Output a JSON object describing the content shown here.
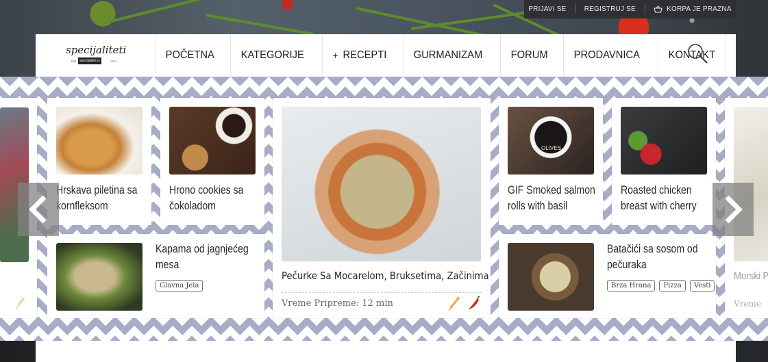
{
  "topbar": {
    "login": "PRIJAVI SE",
    "register": "REGISTRUJ SE",
    "cart": "KORPA JE PRAZNA"
  },
  "logo": {
    "text": "specijaliteti",
    "badge": "specijaliteti.rs",
    "year_left": "EST",
    "year_right": "2017"
  },
  "nav": {
    "items": [
      "POČETNA",
      "KATEGORIJE",
      "RECEPTI",
      "GURMANIZAM",
      "FORUM",
      "PRODAVNICA",
      "KONTAKT"
    ],
    "recepti_prefix": "+"
  },
  "cards": {
    "c1": {
      "title": "Hrskava piletina sa kornfleksom"
    },
    "c2": {
      "title": "Hrono cookies sa čokoladom"
    },
    "c3": {
      "title": "Kapama od jagnjećeg mesa",
      "tags": [
        "Glavna Jela"
      ]
    },
    "featured": {
      "title": "Pečurke Sa Mocarelom, Bruksetima, Začinima",
      "time": "Vreme Pripreme: 12 min"
    },
    "c4": {
      "title": "GIF Smoked salmon rolls with basil",
      "image_label": "OLIVES"
    },
    "c5": {
      "title": "Roasted chicken breast with cherry"
    },
    "c6": {
      "title": "Batačići sa sosom od pečuraka",
      "tags": [
        "Brza Hrana",
        "Pizza",
        "Vesti"
      ]
    },
    "right_partial": {
      "title": "Morski P",
      "time": "Vreme"
    }
  },
  "colors": {
    "chevron": "#a8adc6",
    "topbar": "#2f3033",
    "wheat_icon": "#e0a24a",
    "chili_icon": "#d22b20"
  }
}
